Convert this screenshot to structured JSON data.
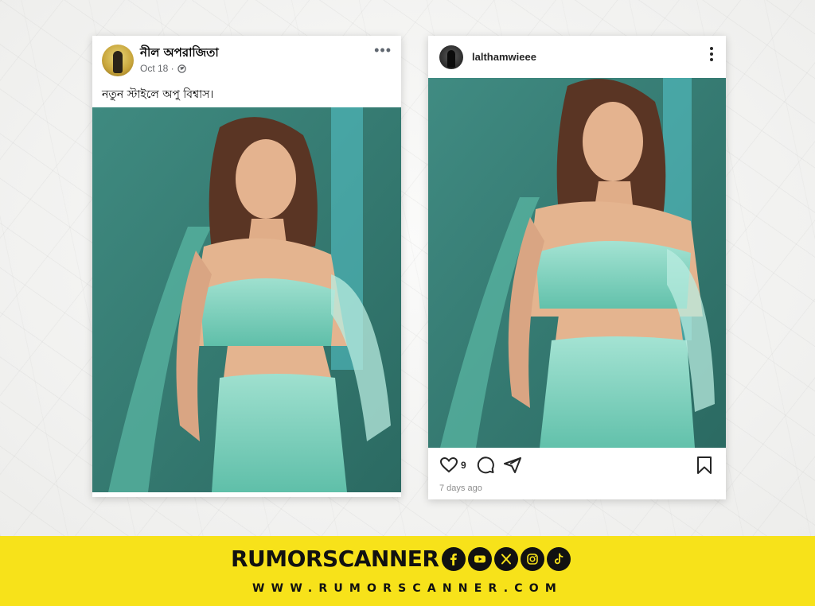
{
  "facebook_post": {
    "author": "নীল অপরাজিতা",
    "date": "Oct 18 ·",
    "caption": "নতুন স্টাইলে অপু বিশ্বাস।",
    "privacy_icon": "globe-icon",
    "more_icon": "more-dots-icon"
  },
  "instagram_post": {
    "username": "lalthamwieee",
    "likes": "9",
    "posted": "7 days ago",
    "icons": [
      "heart-icon",
      "comment-icon",
      "share-icon",
      "bookmark-icon"
    ]
  },
  "footer": {
    "brand": "RUMORSCANNER",
    "url": "WWW.RUMORSCANNER.COM",
    "social_icons": [
      "facebook-icon",
      "youtube-icon",
      "x-icon",
      "instagram-icon",
      "tiktok-icon"
    ],
    "background_color": "#f7e21a"
  }
}
